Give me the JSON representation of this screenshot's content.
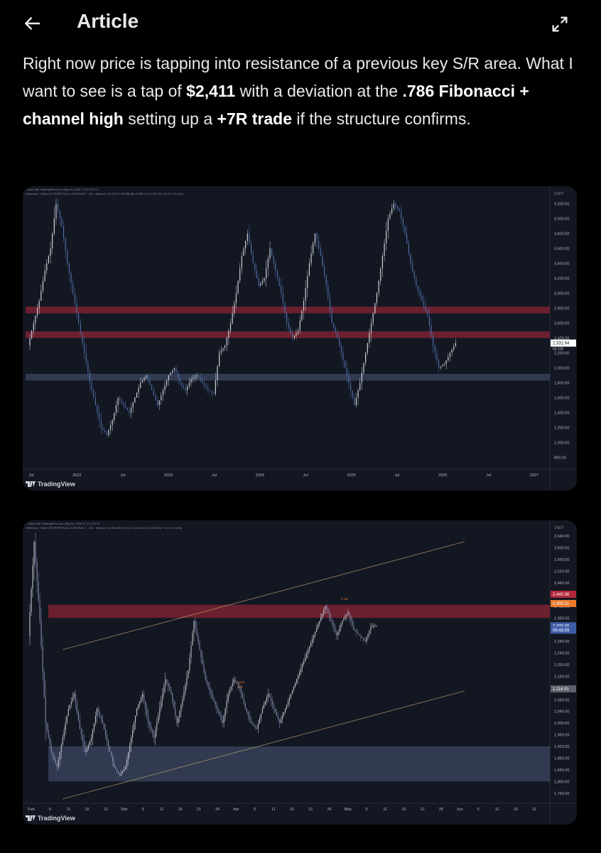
{
  "header": {
    "title": "Article"
  },
  "article": {
    "p1": "Right now price is tapping into resistance of a previous key S/R area. What I want to see is a tap of ",
    "b1": "$2,411",
    "p2": " with a deviation at the ",
    "b2": ".786 Fibonacci + channel high",
    "p3": " setting up a ",
    "b3": "+7R trade",
    "p4": " if the structure confirms."
  },
  "charts": [
    {
      "brand": "TradingView",
      "header_line1": "...ated with TradingView.com, May 04, 2026 17:03 UTC+3",
      "header_line2": "Ethereum / TetherUS PERPETUAL CONTRACT · 1W · Binance  O2,321.67 H2,398.88 L2,308.10 C2,331.94 +10.27 (+0.44%)",
      "colors": {
        "bg": "#131722",
        "resistance": "#b2283a",
        "support": "#4a5878",
        "candle": "#d1d4dc",
        "candle_dark": "#4e6ea8"
      },
      "chart_data": {
        "type": "candlestick",
        "currency": "USDT",
        "x_ticks": [
          "Jul",
          "2022",
          "Jul",
          "2023",
          "Jul",
          "2024",
          "Jul",
          "2025",
          "Jul",
          "2026",
          "Jul",
          "2027"
        ],
        "y_ticks": [
          "4,200.00",
          "4,000.00",
          "3,800.00",
          "3,600.00",
          "3,400.00",
          "3,200.00",
          "3,000.00",
          "2,800.00",
          "2,600.00",
          "2,400.00",
          "2,200.00",
          "2,000.00",
          "1,800.00",
          "1,600.00",
          "1,400.00",
          "1,200.00",
          "1,000.00",
          "800.00"
        ],
        "ylim": [
          700,
          4300
        ],
        "price_label": "2,331.94",
        "price_label_sub": "6d 10h",
        "last_price": 2331.94,
        "zones": [
          {
            "kind": "resistance",
            "from": 2730,
            "to": 2820
          },
          {
            "kind": "resistance",
            "from": 2400,
            "to": 2490
          },
          {
            "kind": "support",
            "from": 1830,
            "to": 1920
          }
        ],
        "series_points": [
          2300,
          2600,
          2900,
          3300,
          3600,
          4200,
          3900,
          3400,
          3000,
          2600,
          2200,
          1800,
          1500,
          1200,
          1100,
          1300,
          1600,
          1500,
          1400,
          1600,
          1800,
          1900,
          1700,
          1500,
          1700,
          1900,
          2000,
          1800,
          1700,
          1850,
          1900,
          1800,
          1700,
          1650,
          2200,
          2300,
          2600,
          3000,
          3500,
          3800,
          3400,
          3100,
          3200,
          3600,
          3300,
          3000,
          2600,
          2400,
          2500,
          2900,
          3400,
          3800,
          3500,
          3100,
          2600,
          2400,
          2100,
          1800,
          1500,
          1800,
          2200,
          2600,
          3000,
          3500,
          4000,
          4200,
          4100,
          3800,
          3400,
          3100,
          2900,
          2700,
          2300,
          2000,
          2050,
          2200,
          2331
        ]
      }
    },
    {
      "brand": "TradingView",
      "header_line1": "...cated with TradingView.com, May 04, 2026 17:11 UTC+3",
      "header_line2": "Ethereum / TetherUS PERPETUAL CONTRACT · 12h · Binance  O2,336.20 H2,343.71 L2,324.20 C2,333.00 −3.20 (−0.14%)",
      "colors": {
        "bg": "#131722",
        "resistance": "#b2283a",
        "support": "#4a5878",
        "candle": "#d1d4dc",
        "channel": "#b8a06a"
      },
      "chart_data": {
        "type": "candlestick",
        "currency": "USDT",
        "x_ticks": [
          "Feb",
          "6",
          "11",
          "16",
          "21",
          "Mar",
          "6",
          "11",
          "16",
          "21",
          "26",
          "Apr",
          "6",
          "11",
          "16",
          "21",
          "26",
          "May",
          "6",
          "11",
          "16",
          "21",
          "26",
          "Jun",
          "6",
          "11",
          "16",
          "21"
        ],
        "y_ticks": [
          "2,640.00",
          "2,600.00",
          "2,560.00",
          "2,520.00",
          "2,480.00",
          "2,440.00",
          "2,400.00",
          "2,360.00",
          "2,320.00",
          "2,280.00",
          "2,240.00",
          "2,200.00",
          "2,160.00",
          "2,120.00",
          "2,080.00",
          "2,040.00",
          "2,000.00",
          "1,960.00",
          "1,920.00",
          "1,880.00",
          "1,840.00",
          "1,800.00",
          "1,760.00"
        ],
        "ylim": [
          1740,
          2660
        ],
        "price_labels": [
          {
            "text": "2,440.96",
            "value": 2440.96,
            "color": "#b2283a"
          },
          {
            "text": "2,409.31",
            "value": 2409.31,
            "color": "#e8792b"
          },
          {
            "text": "2,333.00",
            "value": 2333.0,
            "color": "#3e5ca8"
          },
          {
            "text": "09:48:59",
            "value": 2318,
            "color": "#3e5ca8"
          },
          {
            "text": "2,116.91",
            "value": 2116.91,
            "color": "#5d606b"
          }
        ],
        "fib_labels": [
          "0.786",
          "0.618",
          "0.65"
        ],
        "zones": [
          {
            "kind": "resistance",
            "from": 2360,
            "to": 2405
          },
          {
            "kind": "support",
            "from": 1800,
            "to": 1920
          }
        ],
        "series_points": [
          2300,
          2620,
          2350,
          2000,
          1900,
          1850,
          1950,
          2050,
          2100,
          1980,
          1900,
          1950,
          2050,
          2000,
          1920,
          1850,
          1820,
          1850,
          1950,
          2050,
          2100,
          2000,
          1950,
          2050,
          2150,
          2100,
          2000,
          2080,
          2180,
          2350,
          2250,
          2150,
          2100,
          2050,
          2000,
          2100,
          2150,
          2120,
          2050,
          2000,
          1980,
          2050,
          2100,
          2050,
          2000,
          2050,
          2100,
          2150,
          2200,
          2250,
          2300,
          2350,
          2400,
          2350,
          2300,
          2350,
          2380,
          2320,
          2300,
          2280,
          2330,
          2333
        ]
      }
    }
  ]
}
